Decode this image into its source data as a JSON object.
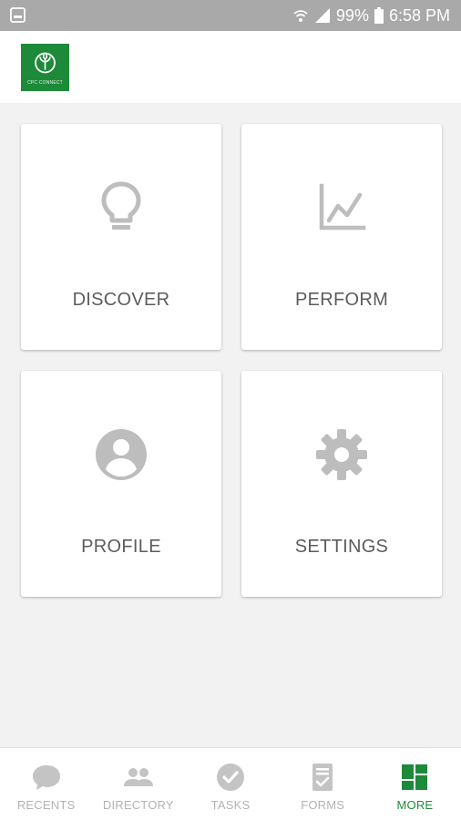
{
  "status_bar": {
    "battery_text": "99%",
    "time": "6:58 PM",
    "icons": [
      "screenshot-icon",
      "wifi-icon",
      "signal-icon",
      "battery-icon"
    ]
  },
  "header": {
    "logo_text": "CPC CONNECT",
    "brand_color": "#1d8a3a"
  },
  "tiles": [
    {
      "label": "DISCOVER",
      "icon": "lightbulb-icon"
    },
    {
      "label": "PERFORM",
      "icon": "chart-line-icon"
    },
    {
      "label": "PROFILE",
      "icon": "account-circle-icon"
    },
    {
      "label": "SETTINGS",
      "icon": "gear-icon"
    }
  ],
  "bottom_nav": {
    "items": [
      {
        "label": "RECENTS",
        "icon": "chat-bubble-icon",
        "active": false
      },
      {
        "label": "DIRECTORY",
        "icon": "people-icon",
        "active": false
      },
      {
        "label": "TASKS",
        "icon": "check-circle-icon",
        "active": false
      },
      {
        "label": "FORMS",
        "icon": "form-document-icon",
        "active": false
      },
      {
        "label": "MORE",
        "icon": "dashboard-grid-icon",
        "active": true
      }
    ],
    "active_color": "#1d8a3a",
    "inactive_color": "#b3b3b3"
  }
}
